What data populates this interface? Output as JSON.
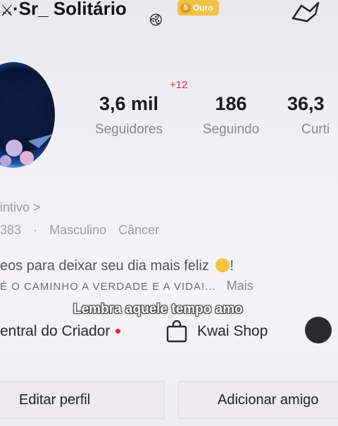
{
  "header": {
    "username": "·Sr_ Solitário",
    "badge_level": "5",
    "badge_label": "Ouro"
  },
  "stats": [
    {
      "value": "3,6 mil",
      "label": "Seguidores",
      "delta": "+12"
    },
    {
      "value": "186",
      "label": "Seguindo"
    },
    {
      "value": "36,3",
      "label": "Curti"
    }
  ],
  "profile": {
    "intivo": "intivo >",
    "meta": [
      "383",
      "·",
      "Masculino",
      "Câncer"
    ],
    "bio_line1": "eos para deixar seu dia mais feliz",
    "bio_line1_end": "!",
    "bio_line2": "É O CAMINHO A VERDADE E A VIDA!...",
    "more": "Mais",
    "caption": "Lembra aquele tempo amo"
  },
  "links": {
    "creator": "entral do Criador",
    "shop": "Kwai Shop"
  },
  "buttons": {
    "edit": "Editar perfil",
    "add_friend": "Adicionar amigo"
  },
  "colors": {
    "accent_red": "#e8283f",
    "badge_gold": "#f0c24a"
  }
}
